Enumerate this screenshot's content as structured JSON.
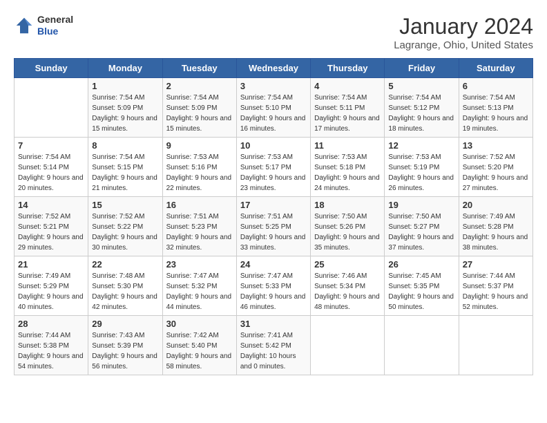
{
  "header": {
    "logo_general": "General",
    "logo_blue": "Blue",
    "month_title": "January 2024",
    "location": "Lagrange, Ohio, United States"
  },
  "weekdays": [
    "Sunday",
    "Monday",
    "Tuesday",
    "Wednesday",
    "Thursday",
    "Friday",
    "Saturday"
  ],
  "weeks": [
    [
      {
        "day": "",
        "sunrise": "",
        "sunset": "",
        "daylight": ""
      },
      {
        "day": "1",
        "sunrise": "Sunrise: 7:54 AM",
        "sunset": "Sunset: 5:09 PM",
        "daylight": "Daylight: 9 hours and 15 minutes."
      },
      {
        "day": "2",
        "sunrise": "Sunrise: 7:54 AM",
        "sunset": "Sunset: 5:09 PM",
        "daylight": "Daylight: 9 hours and 15 minutes."
      },
      {
        "day": "3",
        "sunrise": "Sunrise: 7:54 AM",
        "sunset": "Sunset: 5:10 PM",
        "daylight": "Daylight: 9 hours and 16 minutes."
      },
      {
        "day": "4",
        "sunrise": "Sunrise: 7:54 AM",
        "sunset": "Sunset: 5:11 PM",
        "daylight": "Daylight: 9 hours and 17 minutes."
      },
      {
        "day": "5",
        "sunrise": "Sunrise: 7:54 AM",
        "sunset": "Sunset: 5:12 PM",
        "daylight": "Daylight: 9 hours and 18 minutes."
      },
      {
        "day": "6",
        "sunrise": "Sunrise: 7:54 AM",
        "sunset": "Sunset: 5:13 PM",
        "daylight": "Daylight: 9 hours and 19 minutes."
      }
    ],
    [
      {
        "day": "7",
        "sunrise": "Sunrise: 7:54 AM",
        "sunset": "Sunset: 5:14 PM",
        "daylight": "Daylight: 9 hours and 20 minutes."
      },
      {
        "day": "8",
        "sunrise": "Sunrise: 7:54 AM",
        "sunset": "Sunset: 5:15 PM",
        "daylight": "Daylight: 9 hours and 21 minutes."
      },
      {
        "day": "9",
        "sunrise": "Sunrise: 7:53 AM",
        "sunset": "Sunset: 5:16 PM",
        "daylight": "Daylight: 9 hours and 22 minutes."
      },
      {
        "day": "10",
        "sunrise": "Sunrise: 7:53 AM",
        "sunset": "Sunset: 5:17 PM",
        "daylight": "Daylight: 9 hours and 23 minutes."
      },
      {
        "day": "11",
        "sunrise": "Sunrise: 7:53 AM",
        "sunset": "Sunset: 5:18 PM",
        "daylight": "Daylight: 9 hours and 24 minutes."
      },
      {
        "day": "12",
        "sunrise": "Sunrise: 7:53 AM",
        "sunset": "Sunset: 5:19 PM",
        "daylight": "Daylight: 9 hours and 26 minutes."
      },
      {
        "day": "13",
        "sunrise": "Sunrise: 7:52 AM",
        "sunset": "Sunset: 5:20 PM",
        "daylight": "Daylight: 9 hours and 27 minutes."
      }
    ],
    [
      {
        "day": "14",
        "sunrise": "Sunrise: 7:52 AM",
        "sunset": "Sunset: 5:21 PM",
        "daylight": "Daylight: 9 hours and 29 minutes."
      },
      {
        "day": "15",
        "sunrise": "Sunrise: 7:52 AM",
        "sunset": "Sunset: 5:22 PM",
        "daylight": "Daylight: 9 hours and 30 minutes."
      },
      {
        "day": "16",
        "sunrise": "Sunrise: 7:51 AM",
        "sunset": "Sunset: 5:23 PM",
        "daylight": "Daylight: 9 hours and 32 minutes."
      },
      {
        "day": "17",
        "sunrise": "Sunrise: 7:51 AM",
        "sunset": "Sunset: 5:25 PM",
        "daylight": "Daylight: 9 hours and 33 minutes."
      },
      {
        "day": "18",
        "sunrise": "Sunrise: 7:50 AM",
        "sunset": "Sunset: 5:26 PM",
        "daylight": "Daylight: 9 hours and 35 minutes."
      },
      {
        "day": "19",
        "sunrise": "Sunrise: 7:50 AM",
        "sunset": "Sunset: 5:27 PM",
        "daylight": "Daylight: 9 hours and 37 minutes."
      },
      {
        "day": "20",
        "sunrise": "Sunrise: 7:49 AM",
        "sunset": "Sunset: 5:28 PM",
        "daylight": "Daylight: 9 hours and 38 minutes."
      }
    ],
    [
      {
        "day": "21",
        "sunrise": "Sunrise: 7:49 AM",
        "sunset": "Sunset: 5:29 PM",
        "daylight": "Daylight: 9 hours and 40 minutes."
      },
      {
        "day": "22",
        "sunrise": "Sunrise: 7:48 AM",
        "sunset": "Sunset: 5:30 PM",
        "daylight": "Daylight: 9 hours and 42 minutes."
      },
      {
        "day": "23",
        "sunrise": "Sunrise: 7:47 AM",
        "sunset": "Sunset: 5:32 PM",
        "daylight": "Daylight: 9 hours and 44 minutes."
      },
      {
        "day": "24",
        "sunrise": "Sunrise: 7:47 AM",
        "sunset": "Sunset: 5:33 PM",
        "daylight": "Daylight: 9 hours and 46 minutes."
      },
      {
        "day": "25",
        "sunrise": "Sunrise: 7:46 AM",
        "sunset": "Sunset: 5:34 PM",
        "daylight": "Daylight: 9 hours and 48 minutes."
      },
      {
        "day": "26",
        "sunrise": "Sunrise: 7:45 AM",
        "sunset": "Sunset: 5:35 PM",
        "daylight": "Daylight: 9 hours and 50 minutes."
      },
      {
        "day": "27",
        "sunrise": "Sunrise: 7:44 AM",
        "sunset": "Sunset: 5:37 PM",
        "daylight": "Daylight: 9 hours and 52 minutes."
      }
    ],
    [
      {
        "day": "28",
        "sunrise": "Sunrise: 7:44 AM",
        "sunset": "Sunset: 5:38 PM",
        "daylight": "Daylight: 9 hours and 54 minutes."
      },
      {
        "day": "29",
        "sunrise": "Sunrise: 7:43 AM",
        "sunset": "Sunset: 5:39 PM",
        "daylight": "Daylight: 9 hours and 56 minutes."
      },
      {
        "day": "30",
        "sunrise": "Sunrise: 7:42 AM",
        "sunset": "Sunset: 5:40 PM",
        "daylight": "Daylight: 9 hours and 58 minutes."
      },
      {
        "day": "31",
        "sunrise": "Sunrise: 7:41 AM",
        "sunset": "Sunset: 5:42 PM",
        "daylight": "Daylight: 10 hours and 0 minutes."
      },
      {
        "day": "",
        "sunrise": "",
        "sunset": "",
        "daylight": ""
      },
      {
        "day": "",
        "sunrise": "",
        "sunset": "",
        "daylight": ""
      },
      {
        "day": "",
        "sunrise": "",
        "sunset": "",
        "daylight": ""
      }
    ]
  ]
}
